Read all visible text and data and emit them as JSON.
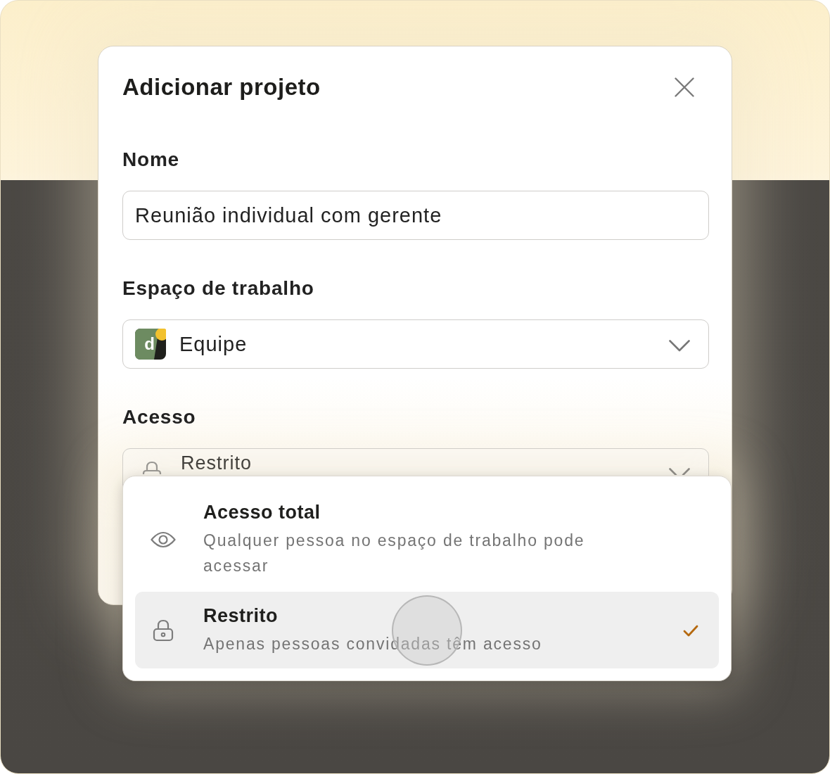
{
  "dialog": {
    "title": "Adicionar projeto",
    "fields": [
      {
        "kind": "text",
        "label": "Nome",
        "value": "Reunião individual com gerente"
      },
      {
        "kind": "workspace",
        "label": "Espaço de trabalho",
        "value": "Equipe",
        "logo_letter": "d"
      },
      {
        "kind": "access",
        "label": "Acesso",
        "value": "Restrito"
      }
    ]
  },
  "access_menu": {
    "options": [
      {
        "kind": "full",
        "title": "Acesso total",
        "description": "Qualquer pessoa no espaço de trabalho pode acessar",
        "selected": false
      },
      {
        "kind": "restricted",
        "title": "Restrito",
        "description": "Apenas pessoas convidadas têm acesso",
        "selected": true
      }
    ]
  }
}
